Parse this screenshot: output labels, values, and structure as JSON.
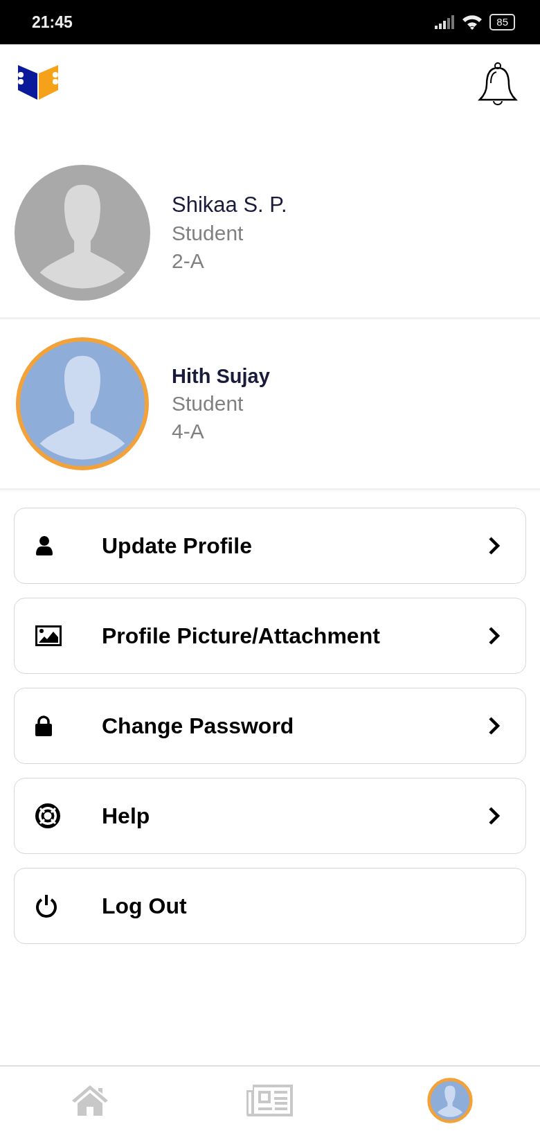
{
  "status_bar": {
    "time": "21:45",
    "battery": "85"
  },
  "profiles": [
    {
      "name": "Shikaa S. P.",
      "role": "Student",
      "class": "2-A",
      "selected": false
    },
    {
      "name": "Hith Sujay",
      "role": "Student",
      "class": "4-A",
      "selected": true
    }
  ],
  "menu": [
    {
      "label": "Update Profile",
      "kind": "link"
    },
    {
      "label": "Profile Picture/Attachment",
      "kind": "link"
    },
    {
      "label": "Change Password",
      "kind": "link"
    },
    {
      "label": "Help",
      "kind": "link"
    },
    {
      "label": "Log Out",
      "kind": "action"
    }
  ],
  "bottom_nav": [
    {
      "selected": false
    },
    {
      "selected": false
    },
    {
      "selected": true
    }
  ]
}
